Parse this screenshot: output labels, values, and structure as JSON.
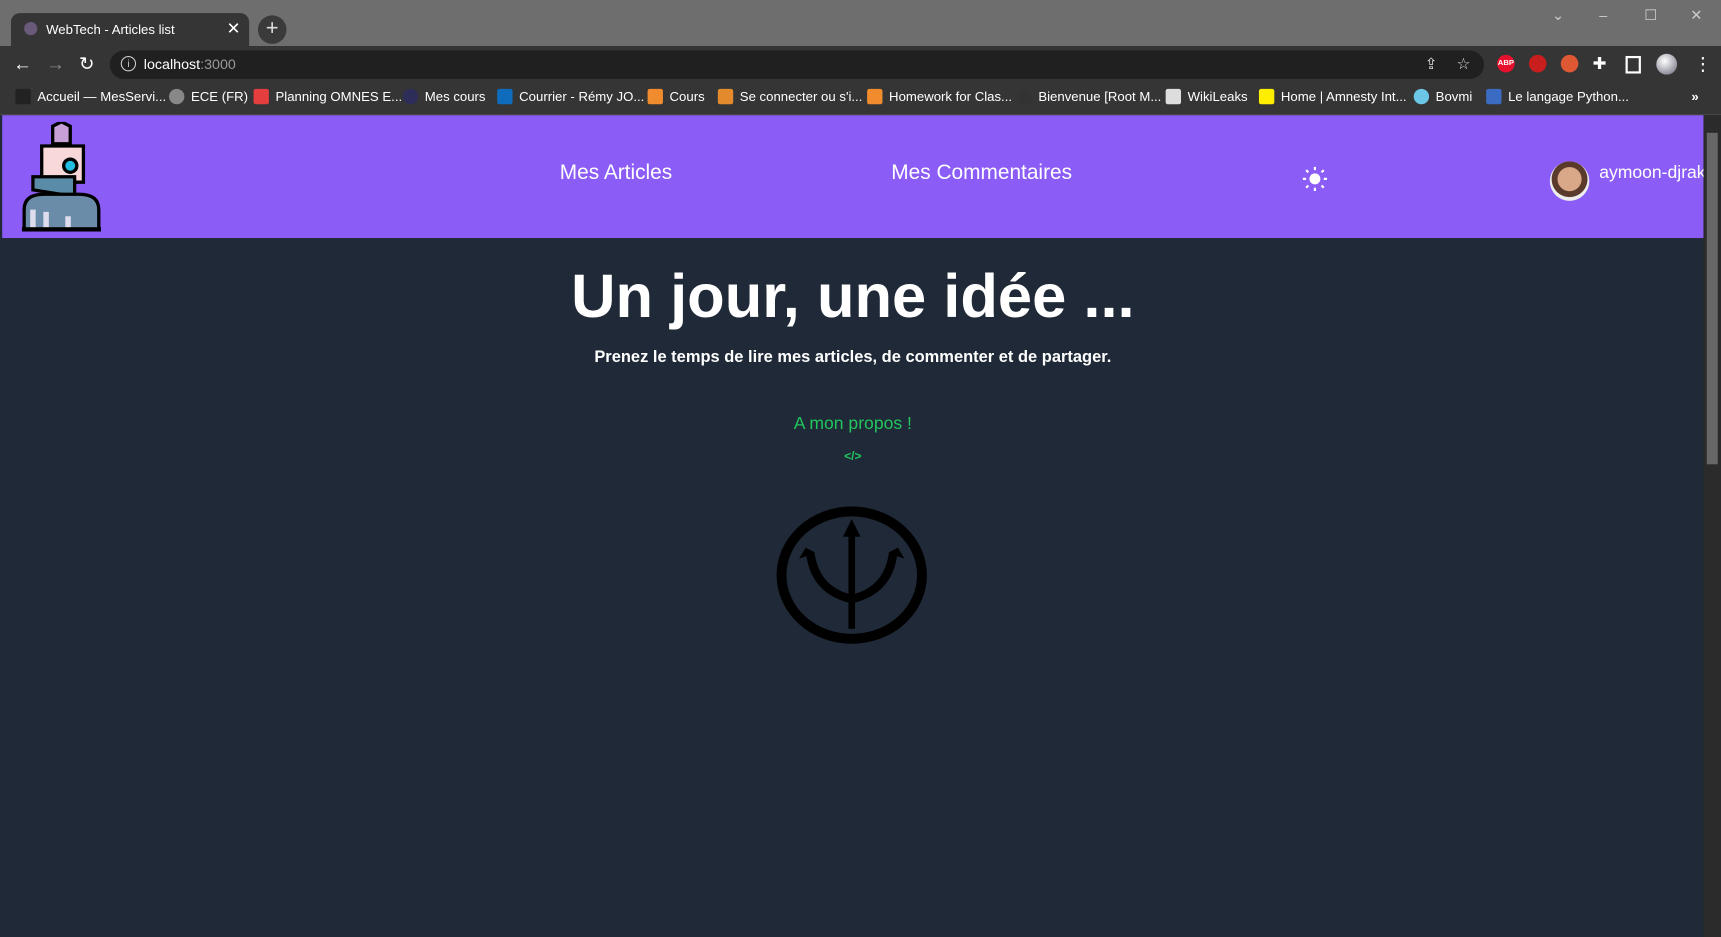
{
  "browser": {
    "tab_title": "WebTech - Articles list",
    "url_host": "localhost",
    "url_port": ":3000",
    "bookmarks": [
      {
        "label": "Accueil — MesServi...",
        "color": "#222"
      },
      {
        "label": "ECE (FR)",
        "color": "#888"
      },
      {
        "label": "Planning OMNES E...",
        "color": "#e53e3e"
      },
      {
        "label": "Mes cours",
        "color": "#2d2d5a"
      },
      {
        "label": "Courrier - Rémy JO...",
        "color": "#0f6cbd"
      },
      {
        "label": "Cours",
        "color": "#f08c2e"
      },
      {
        "label": "Se connecter ou s'i...",
        "color": "#e38b2c"
      },
      {
        "label": "Homework for Clas...",
        "color": "#f08c2e"
      },
      {
        "label": "Bienvenue [Root M...",
        "color": "#333"
      },
      {
        "label": "WikiLeaks",
        "color": "#ddd"
      },
      {
        "label": "Home | Amnesty Int...",
        "color": "#ffee00"
      },
      {
        "label": "Bovmi",
        "color": "#6cc6e8"
      },
      {
        "label": "Le langage Python...",
        "color": "#3b6cc4"
      }
    ],
    "more_bookmarks": "»",
    "extensions": [
      {
        "name": "adblock",
        "label": "ABP",
        "color": "#e8112d"
      },
      {
        "name": "shield",
        "label": "",
        "color": "#c81e1e"
      },
      {
        "name": "duckduckgo",
        "label": "",
        "color": "#de5833"
      }
    ]
  },
  "header": {
    "nav": [
      "Mes Articles",
      "Mes Commentaires"
    ],
    "username": "aymoon-djrak"
  },
  "hero": {
    "title": "Un jour, une idée ...",
    "subtitle": "Prenez le temps de lire mes articles, de commenter et de partager.",
    "about_link": "A mon propos !",
    "code_glyph": "</>"
  }
}
